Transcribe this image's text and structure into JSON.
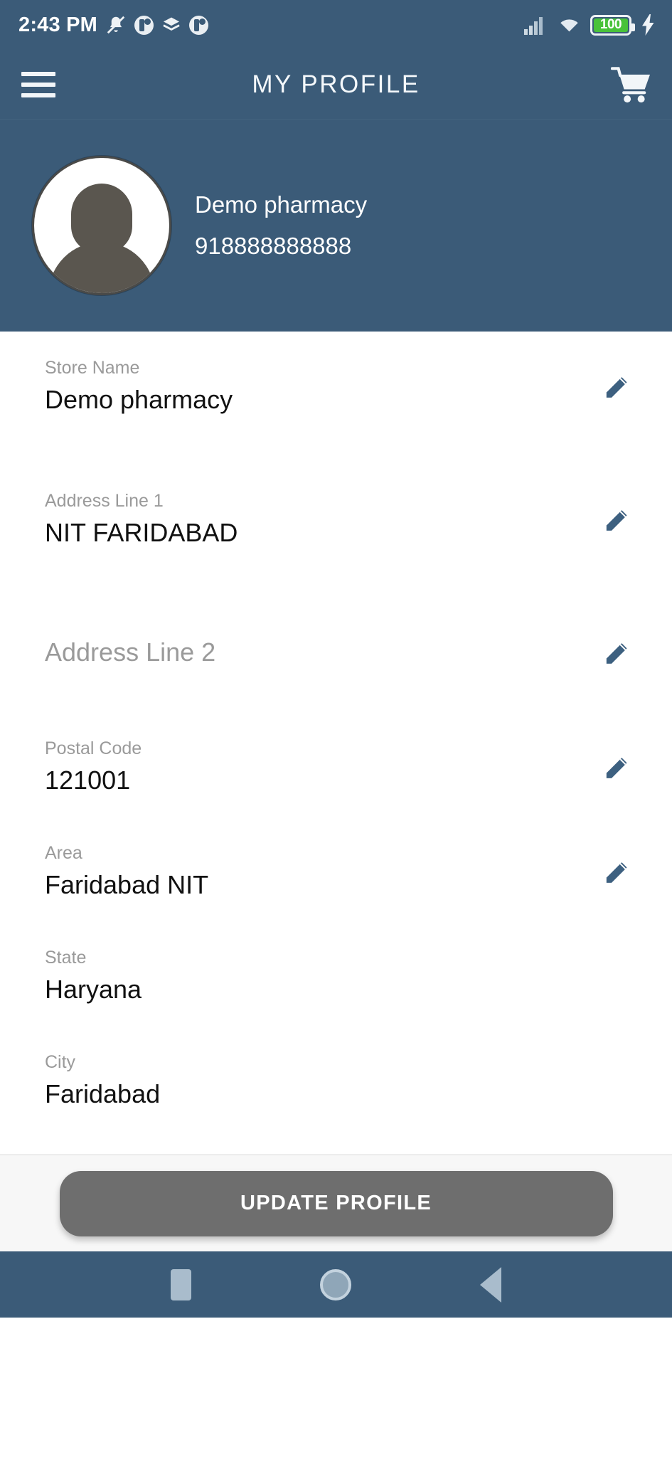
{
  "colors": {
    "header_blue": "#3b5b78",
    "accent_pencil": "#3d6080",
    "battery_green": "#49c23a",
    "button_gray": "#6e6e6e",
    "label_gray": "#9a9a9a",
    "value_black": "#111111"
  },
  "statusbar": {
    "time": "2:43 PM",
    "left_icons": [
      "bell-mute-icon",
      "app-notification-icon",
      "layers-icon",
      "app-notification-icon"
    ],
    "right_icons": [
      "cellular-signal-icon",
      "wifi-icon",
      "battery-icon",
      "charging-bolt-icon"
    ],
    "battery_level": "100"
  },
  "appbar": {
    "menu_icon": "hamburger-menu-icon",
    "title": "MY PROFILE",
    "cart_icon": "shopping-cart-icon"
  },
  "profile": {
    "avatar_icon": "default-person-avatar",
    "name": "Demo pharmacy",
    "phone": "918888888888"
  },
  "form": {
    "fields": [
      {
        "label": "Store Name",
        "value": "Demo pharmacy",
        "placeholder": "",
        "editable": true,
        "empty": false
      },
      {
        "label": "Address Line 1",
        "value": "NIT FARIDABAD",
        "placeholder": "",
        "editable": true,
        "empty": false
      },
      {
        "label": "",
        "value": "",
        "placeholder": "Address Line 2",
        "editable": true,
        "empty": true
      },
      {
        "label": "Postal Code",
        "value": "121001",
        "placeholder": "",
        "editable": true,
        "empty": false
      },
      {
        "label": "Area",
        "value": "Faridabad NIT",
        "placeholder": "",
        "editable": true,
        "empty": false
      },
      {
        "label": "State",
        "value": "Haryana",
        "placeholder": "",
        "editable": false,
        "empty": false
      },
      {
        "label": "City",
        "value": "Faridabad",
        "placeholder": "",
        "editable": false,
        "empty": false
      }
    ],
    "edit_icon": "pencil-edit-icon"
  },
  "footer": {
    "update_label": "UPDATE PROFILE"
  },
  "navbar": {
    "recents_icon": "square-recents-icon",
    "home_icon": "circle-home-icon",
    "back_icon": "triangle-back-icon"
  }
}
